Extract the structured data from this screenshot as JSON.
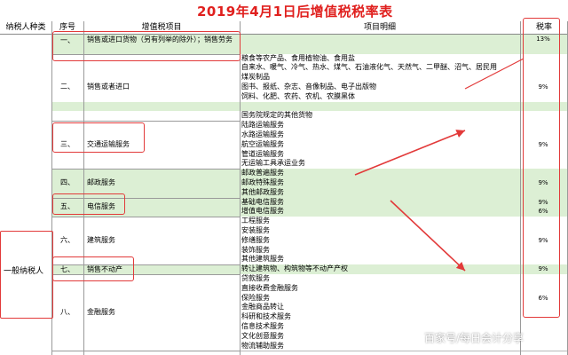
{
  "title": "2019年4月1日后增值税税率表",
  "headers": {
    "taxpayer_type": "纳税人种类",
    "seq": "序号",
    "vat_item": "增值税项目",
    "detail": "项目明细",
    "rate": "税率"
  },
  "taxpayer_label": "一般纳税人",
  "groups": [
    {
      "seq": "一、",
      "item": "销售或进口货物（另有列举的除外）；销售劳务"
    },
    {
      "seq": "二、",
      "item": "销售或者进口"
    },
    {
      "seq": "三、",
      "item": "交通运输服务"
    },
    {
      "seq": "四、",
      "item": "邮政服务"
    },
    {
      "seq": "五、",
      "item": "电信服务"
    },
    {
      "seq": "六、",
      "item": "建筑服务"
    },
    {
      "seq": "七、",
      "item": "销售不动产"
    },
    {
      "seq": "八、",
      "item": "金融服务"
    }
  ],
  "rows": [
    {
      "detail": "",
      "rate": "13%"
    },
    {
      "detail": "",
      "rate": ""
    },
    {
      "detail": "粮食等农产品、食用植物油、食用盐",
      "rate": ""
    },
    {
      "detail": "自来水、暖气、冷气、热水、煤气、石油液化气、天然气、二甲醚、沼气、居民用",
      "rate": ""
    },
    {
      "detail": "煤炭制品",
      "rate": ""
    },
    {
      "detail": "图书、报纸、杂志、音像制品、电子出版物",
      "rate": "9%"
    },
    {
      "detail": "饲料、化肥、农药、农机、农膜黑体",
      "rate": ""
    },
    {
      "detail": "",
      "rate": ""
    },
    {
      "detail": "国务院规定的其他货物",
      "rate": ""
    },
    {
      "detail": "陆路运输服务",
      "rate": ""
    },
    {
      "detail": "水路运输服务",
      "rate": ""
    },
    {
      "detail": "航空运输服务",
      "rate": "9%"
    },
    {
      "detail": "管道运输服务",
      "rate": ""
    },
    {
      "detail": "无运输工具承运业务",
      "rate": ""
    },
    {
      "detail": "邮政普遍服务",
      "rate": ""
    },
    {
      "detail": "邮政特殊服务",
      "rate": "9%"
    },
    {
      "detail": "其他邮政服务",
      "rate": ""
    },
    {
      "detail": "基础电信服务",
      "rate": "9%"
    },
    {
      "detail": "增值电信服务",
      "rate": "6%"
    },
    {
      "detail": "工程服务",
      "rate": ""
    },
    {
      "detail": "安装服务",
      "rate": ""
    },
    {
      "detail": "修缮服务",
      "rate": "9%"
    },
    {
      "detail": "装饰服务",
      "rate": ""
    },
    {
      "detail": "其他建筑服务",
      "rate": ""
    },
    {
      "detail": "转让建筑物、构筑物等不动产产权",
      "rate": "9%"
    },
    {
      "detail": "贷款服务",
      "rate": ""
    },
    {
      "detail": "直接收费金融服务",
      "rate": ""
    },
    {
      "detail": "保险服务",
      "rate": "6%"
    },
    {
      "detail": "金融商品转让",
      "rate": ""
    },
    {
      "detail": "科研和技术服务",
      "rate": ""
    },
    {
      "detail": "信息技术服务",
      "rate": ""
    },
    {
      "detail": "文化创意服务",
      "rate": ""
    },
    {
      "detail": "物流辅助服务",
      "rate": ""
    }
  ],
  "watermark": "百家号/每日会计分享",
  "colors": {
    "title": "#e0201e",
    "annotation": "#e23a3a",
    "row_band": "#dcefd4"
  }
}
